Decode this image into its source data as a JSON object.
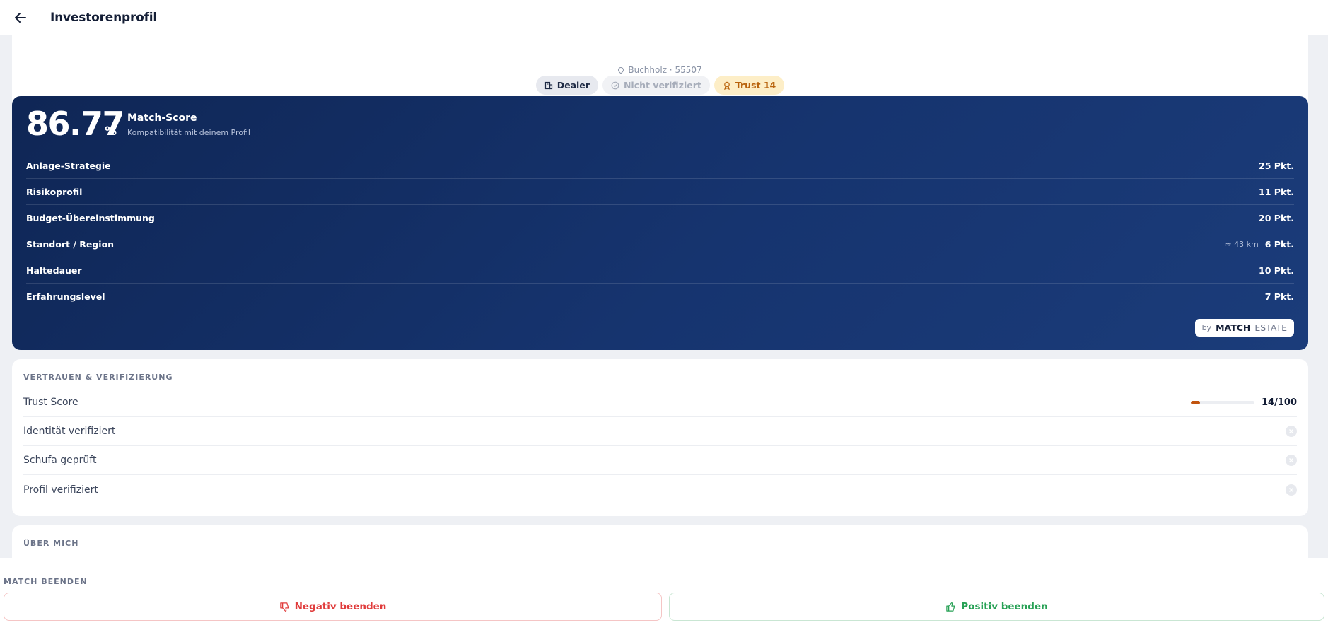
{
  "header": {
    "title": "Investorenprofil"
  },
  "profile": {
    "location": "Buchholz · 55507",
    "badges": {
      "dealer": "Dealer",
      "unverified": "Nicht verifiziert",
      "trust": "Trust 14"
    }
  },
  "match": {
    "score": "86.77",
    "percent_sign": "%",
    "title": "Match-Score",
    "subtitle": "Kompatibilität mit deinem Profil",
    "criteria": [
      {
        "label": "Anlage-Strategie",
        "points": "25 Pkt."
      },
      {
        "label": "Risikoprofil",
        "points": "11 Pkt."
      },
      {
        "label": "Budget-Übereinstimmung",
        "points": "20 Pkt."
      },
      {
        "label": "Standort / Region",
        "extra": "≈ 43 km",
        "points": "6 Pkt."
      },
      {
        "label": "Haltedauer",
        "points": "10 Pkt."
      },
      {
        "label": "Erfahrungslevel",
        "points": "7 Pkt."
      }
    ],
    "brand": {
      "by": "by",
      "match": "MATCH",
      "estate": "ESTATE"
    }
  },
  "trust": {
    "section_label": "VERTRAUEN & VERIFIZIERUNG",
    "score_label": "Trust Score",
    "score_value": "14/100",
    "score_fraction": 0.14,
    "rows": [
      {
        "label": "Identität verifiziert"
      },
      {
        "label": "Schufa geprüft"
      },
      {
        "label": "Profil verifiziert"
      }
    ]
  },
  "about": {
    "section_label": "ÜBER MICH"
  },
  "end_match": {
    "section_label": "MATCH BEENDEN",
    "negative": "Negativ beenden",
    "positive": "Positiv beenden"
  },
  "colors": {
    "navy": "#0f2655",
    "trust_orange": "#c2540e",
    "negative_red": "#e03b3b",
    "positive_green": "#27a155"
  }
}
